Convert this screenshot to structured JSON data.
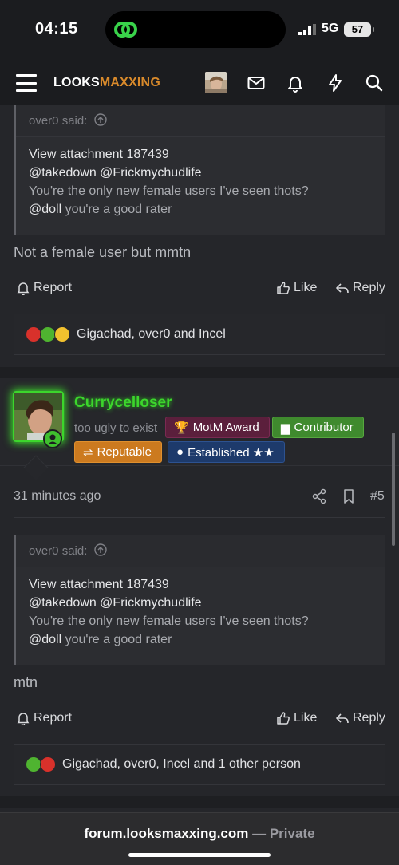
{
  "status": {
    "time": "04:15",
    "network": "5G",
    "battery": "57"
  },
  "nav": {
    "logo_a": "LOOKS",
    "logo_b": "MAXXING"
  },
  "post1": {
    "quote_author": "over0 said:",
    "quote_lines": [
      "View attachment 187439",
      "@takedown @Frickmychudlife",
      "You're the only new female users I've seen thots?",
      "@doll",
      " you're a good rater"
    ],
    "text": "Not a female user but mmtn",
    "report": "Report",
    "like": "Like",
    "reply": "Reply",
    "reactions_text": "Gigachad, over0 and Incel"
  },
  "post2": {
    "username": "Currycelloser",
    "user_title": "too ugly to exist",
    "badges": [
      "MotM Award",
      "Contributor",
      "Reputable",
      "Established ★★"
    ],
    "time": "31 minutes ago",
    "post_number": "#5",
    "quote_author": "over0 said:",
    "quote_lines": [
      "View attachment 187439",
      "@takedown @Frickmychudlife",
      "You're the only new female users I've seen thots?",
      "@doll",
      " you're a good rater"
    ],
    "text": "mtn",
    "report": "Report",
    "like": "Like",
    "reply": "Reply",
    "reactions_text": "Gigachad, over0, Incel and 1 other person"
  },
  "browser": {
    "domain": "forum.looksmaxxing.com",
    "sep": " — ",
    "mode": "Private"
  }
}
